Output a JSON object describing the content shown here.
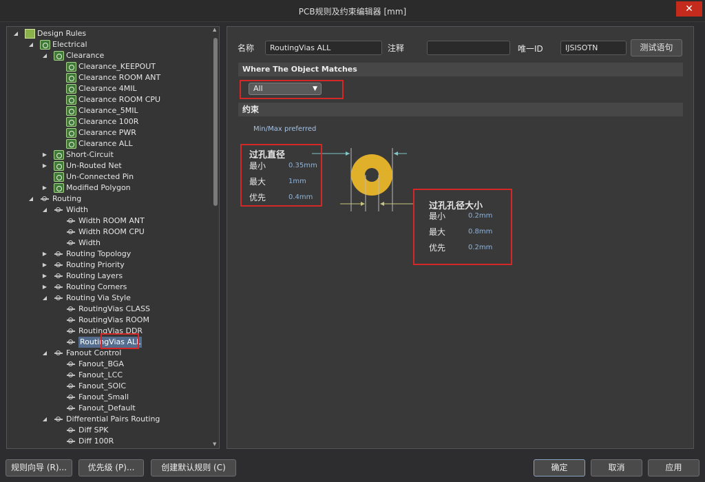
{
  "window": {
    "title": "PCB规则及约束编辑器 [mm]",
    "close_glyph": "✕"
  },
  "tree": [
    {
      "label": "Design Rules",
      "level": 0,
      "expander": "open",
      "icon": "folder-icon"
    },
    {
      "label": "Electrical",
      "level": 1,
      "expander": "open",
      "icon": "rule-icon"
    },
    {
      "label": "Clearance",
      "level": 2,
      "expander": "open",
      "icon": "rule-icon"
    },
    {
      "label": "Clearance_KEEPOUT",
      "level": 3,
      "expander": "none",
      "icon": "rule-icon"
    },
    {
      "label": "Clearance ROOM ANT",
      "level": 3,
      "expander": "none",
      "icon": "rule-icon"
    },
    {
      "label": "Clearance 4MIL",
      "level": 3,
      "expander": "none",
      "icon": "rule-icon"
    },
    {
      "label": "Clearance ROOM CPU",
      "level": 3,
      "expander": "none",
      "icon": "rule-icon"
    },
    {
      "label": "Clearance_5MIL",
      "level": 3,
      "expander": "none",
      "icon": "rule-icon"
    },
    {
      "label": "Clearance 100R",
      "level": 3,
      "expander": "none",
      "icon": "rule-icon"
    },
    {
      "label": "Clearance PWR",
      "level": 3,
      "expander": "none",
      "icon": "rule-icon"
    },
    {
      "label": "Clearance ALL",
      "level": 3,
      "expander": "none",
      "icon": "rule-icon"
    },
    {
      "label": "Short-Circuit",
      "level": 2,
      "expander": "closed",
      "icon": "rule-icon"
    },
    {
      "label": "Un-Routed Net",
      "level": 2,
      "expander": "closed",
      "icon": "rule-icon"
    },
    {
      "label": "Un-Connected Pin",
      "level": 2,
      "expander": "none",
      "icon": "rule-icon"
    },
    {
      "label": "Modified Polygon",
      "level": 2,
      "expander": "closed",
      "icon": "rule-icon"
    },
    {
      "label": "Routing",
      "level": 1,
      "expander": "open",
      "icon": "route-icon"
    },
    {
      "label": "Width",
      "level": 2,
      "expander": "open",
      "icon": "route-icon"
    },
    {
      "label": "Width ROOM ANT",
      "level": 3,
      "expander": "none",
      "icon": "route-icon"
    },
    {
      "label": "Width ROOM CPU",
      "level": 3,
      "expander": "none",
      "icon": "route-icon"
    },
    {
      "label": "Width",
      "level": 3,
      "expander": "none",
      "icon": "route-icon"
    },
    {
      "label": "Routing Topology",
      "level": 2,
      "expander": "closed",
      "icon": "route-icon"
    },
    {
      "label": "Routing Priority",
      "level": 2,
      "expander": "closed",
      "icon": "route-icon"
    },
    {
      "label": "Routing Layers",
      "level": 2,
      "expander": "closed",
      "icon": "route-icon"
    },
    {
      "label": "Routing Corners",
      "level": 2,
      "expander": "closed",
      "icon": "route-icon"
    },
    {
      "label": "Routing Via Style",
      "level": 2,
      "expander": "open",
      "icon": "route-icon"
    },
    {
      "label": "RoutingVias CLASS",
      "level": 3,
      "expander": "none",
      "icon": "route-icon"
    },
    {
      "label": "RoutingVias ROOM",
      "level": 3,
      "expander": "none",
      "icon": "route-icon"
    },
    {
      "label": "RoutingVias DDR",
      "level": 3,
      "expander": "none",
      "icon": "route-icon"
    },
    {
      "label": "RoutingVias ALL",
      "level": 3,
      "expander": "none",
      "icon": "route-icon",
      "selected": true
    },
    {
      "label": "Fanout Control",
      "level": 2,
      "expander": "open",
      "icon": "route-icon"
    },
    {
      "label": "Fanout_BGA",
      "level": 3,
      "expander": "none",
      "icon": "route-icon"
    },
    {
      "label": "Fanout_LCC",
      "level": 3,
      "expander": "none",
      "icon": "route-icon"
    },
    {
      "label": "Fanout_SOIC",
      "level": 3,
      "expander": "none",
      "icon": "route-icon"
    },
    {
      "label": "Fanout_Small",
      "level": 3,
      "expander": "none",
      "icon": "route-icon"
    },
    {
      "label": "Fanout_Default",
      "level": 3,
      "expander": "none",
      "icon": "route-icon"
    },
    {
      "label": "Differential Pairs Routing",
      "level": 2,
      "expander": "open",
      "icon": "route-icon"
    },
    {
      "label": "Diff SPK",
      "level": 3,
      "expander": "none",
      "icon": "route-icon"
    },
    {
      "label": "Diff 100R",
      "level": 3,
      "expander": "none",
      "icon": "route-icon"
    }
  ],
  "rule": {
    "name_label": "名称",
    "name_value": "RoutingVias ALL",
    "comment_label": "注释",
    "comment_value": "",
    "uid_label": "唯一ID",
    "uid_value": "IJSISOTN",
    "test_button": "测试语句"
  },
  "where": {
    "header": "Where The Object Matches",
    "selected": "All"
  },
  "constraints": {
    "header": "约束",
    "mode": "Min/Max preferred",
    "via_diameter": {
      "title": "过孔直径",
      "min_label": "最小",
      "min_value": "0.35mm",
      "max_label": "最大",
      "max_value": "1mm",
      "pref_label": "优先",
      "pref_value": "0.4mm"
    },
    "hole_size": {
      "title": "过孔孔径大小",
      "min_label": "最小",
      "min_value": "0.2mm",
      "max_label": "最大",
      "max_value": "0.8mm",
      "pref_label": "优先",
      "pref_value": "0.2mm"
    },
    "via_color": "#e0b02a"
  },
  "footer": {
    "wizard": "规则向导 (R)...",
    "priority": "优先级 (P)...",
    "create_default": "创建默认规则 (C)",
    "ok": "确定",
    "cancel": "取消",
    "apply": "应用"
  }
}
